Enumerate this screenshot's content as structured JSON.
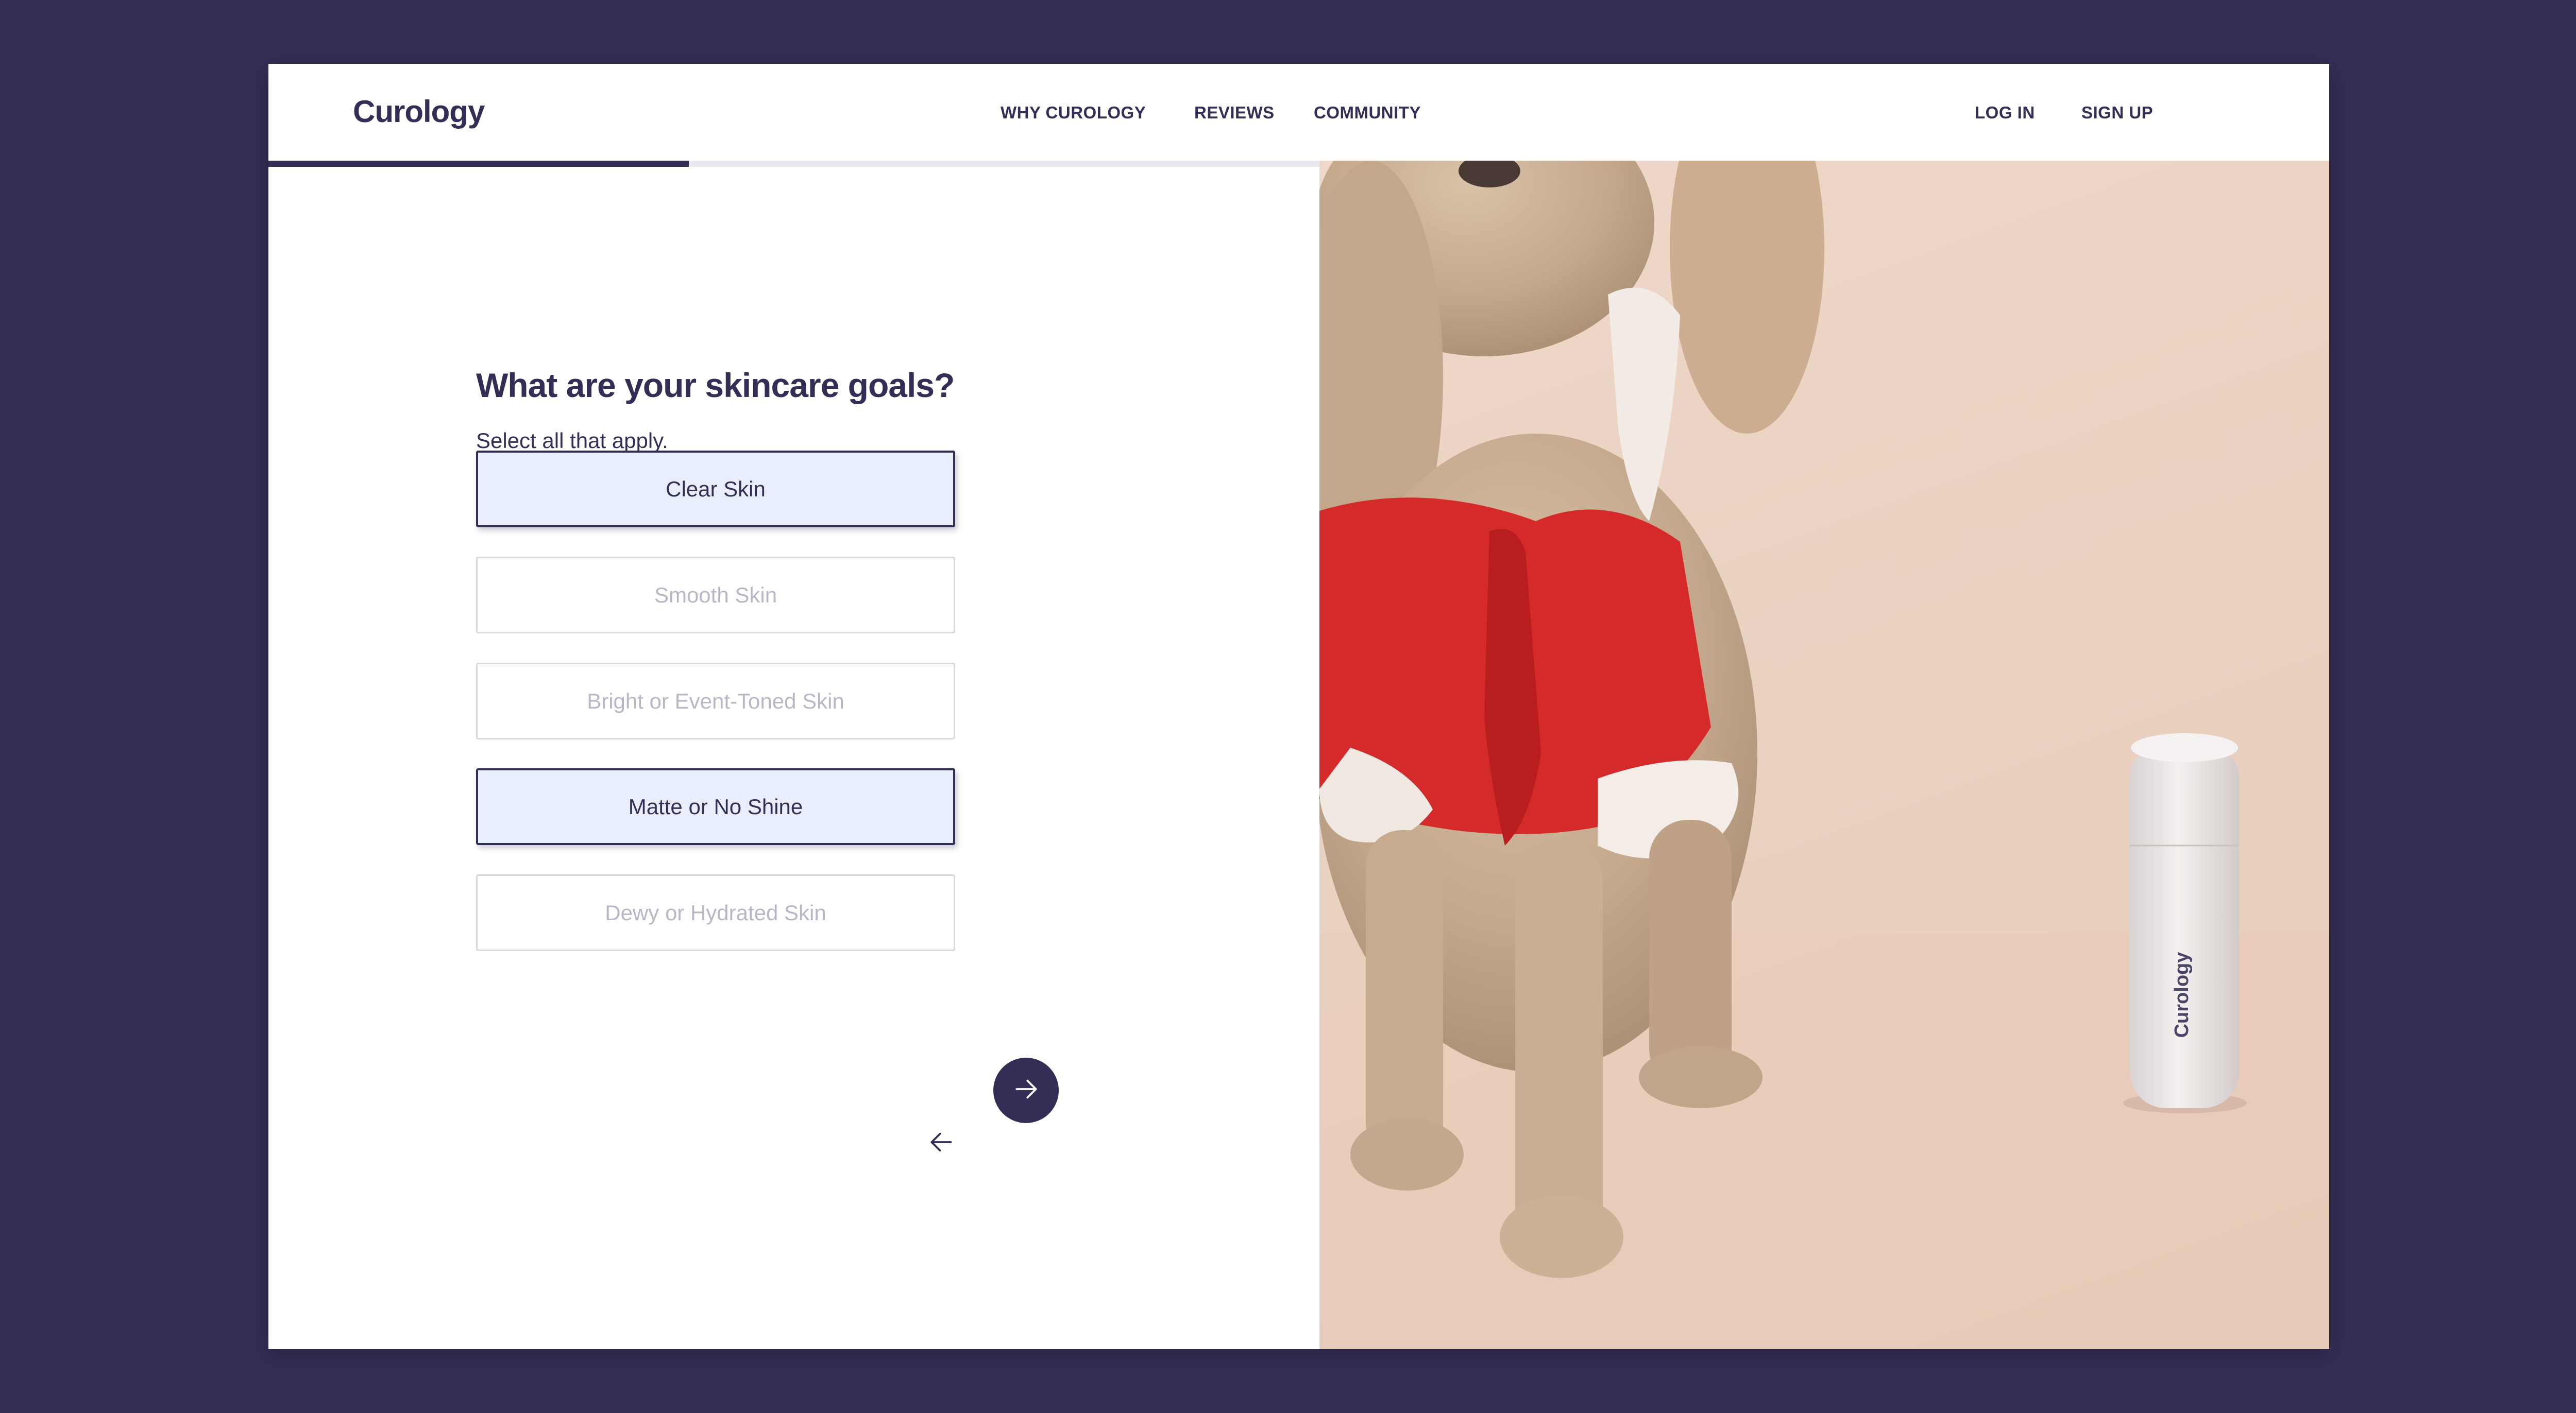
{
  "header": {
    "logo": "Curology",
    "nav": {
      "why": "WHY CUROLOGY",
      "reviews": "REVIEWS",
      "community": "COMMUNITY",
      "login": "LOG IN",
      "signup": "SIGN UP"
    }
  },
  "quiz": {
    "question": "What are your skincare goals?",
    "subtitle": "Select all that apply.",
    "progress": 0.4,
    "options": [
      {
        "label": "Clear Skin",
        "selected": true
      },
      {
        "label": "Smooth Skin",
        "selected": false
      },
      {
        "label": "Bright or Event-Toned Skin",
        "selected": false
      },
      {
        "label": "Matte or No Shine",
        "selected": true
      },
      {
        "label": "Dewy or Hydrated Skin",
        "selected": false
      }
    ]
  },
  "icons": {
    "back": "arrow-left-icon",
    "next": "arrow-right-icon"
  },
  "photo": {
    "bottle_text": "Curology"
  },
  "colors": {
    "brand": "#332e55",
    "selected_bg": "#e9eefc",
    "background": "#332e55",
    "photo_bg": "#ecd5c5",
    "sweater_red": "#d42a2a"
  }
}
